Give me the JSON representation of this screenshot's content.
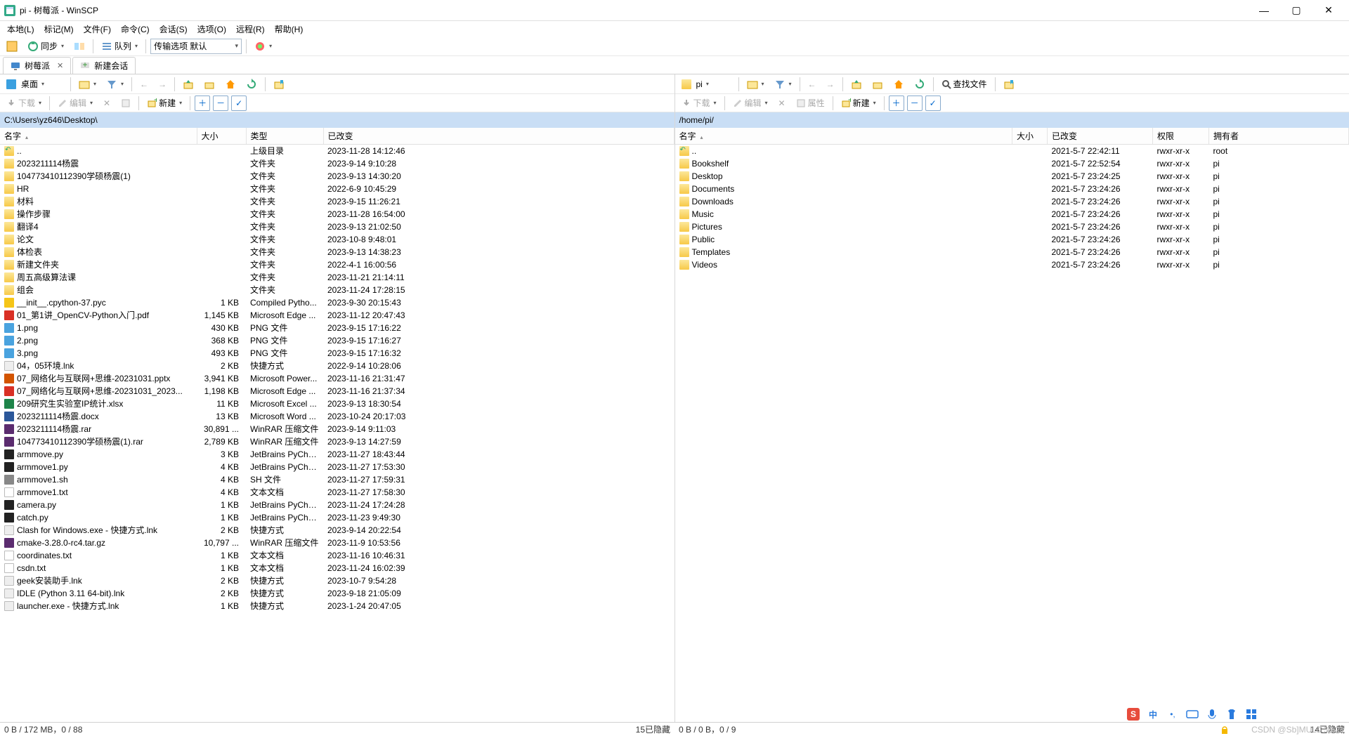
{
  "window": {
    "title": "pi - 树莓派 - WinSCP"
  },
  "menubar": [
    "本地(L)",
    "标记(M)",
    "文件(F)",
    "命令(C)",
    "会话(S)",
    "选项(O)",
    "远程(R)",
    "帮助(H)"
  ],
  "toolbar1": {
    "sync": "同步",
    "queue": "队列",
    "transfer": "传输选项 默认"
  },
  "tabs": {
    "session": "树莓派",
    "newsession": "新建会话"
  },
  "left": {
    "drive": "桌面",
    "path": "C:\\Users\\yz646\\Desktop\\",
    "edit": "编辑",
    "new": "新建",
    "download": "下载",
    "cols": {
      "name": "名字",
      "size": "大小",
      "type": "类型",
      "changed": "已改变"
    },
    "rows": [
      {
        "ic": "up",
        "name": "..",
        "size": "",
        "type": "上级目录",
        "changed": "2023-11-28  14:12:46"
      },
      {
        "ic": "folder",
        "name": "2023211114杨震",
        "size": "",
        "type": "文件夹",
        "changed": "2023-9-14  9:10:28"
      },
      {
        "ic": "folder",
        "name": "104773410112390学硕杨震(1)",
        "size": "",
        "type": "文件夹",
        "changed": "2023-9-13  14:30:20"
      },
      {
        "ic": "folder",
        "name": "HR",
        "size": "",
        "type": "文件夹",
        "changed": "2022-6-9  10:45:29"
      },
      {
        "ic": "folder",
        "name": "材料",
        "size": "",
        "type": "文件夹",
        "changed": "2023-9-15  11:26:21"
      },
      {
        "ic": "folder",
        "name": "操作步骤",
        "size": "",
        "type": "文件夹",
        "changed": "2023-11-28  16:54:00"
      },
      {
        "ic": "folder",
        "name": "翻译4",
        "size": "",
        "type": "文件夹",
        "changed": "2023-9-13  21:02:50"
      },
      {
        "ic": "folder",
        "name": "论文",
        "size": "",
        "type": "文件夹",
        "changed": "2023-10-8  9:48:01"
      },
      {
        "ic": "folder",
        "name": "体检表",
        "size": "",
        "type": "文件夹",
        "changed": "2023-9-13  14:38:23"
      },
      {
        "ic": "folder",
        "name": "新建文件夹",
        "size": "",
        "type": "文件夹",
        "changed": "2022-4-1  16:00:56"
      },
      {
        "ic": "folder",
        "name": "周五高级算法课",
        "size": "",
        "type": "文件夹",
        "changed": "2023-11-21  21:14:11"
      },
      {
        "ic": "folder",
        "name": "组会",
        "size": "",
        "type": "文件夹",
        "changed": "2023-11-24  17:28:15"
      },
      {
        "ic": "pyc",
        "name": "__init__.cpython-37.pyc",
        "size": "1 KB",
        "type": "Compiled Pytho...",
        "changed": "2023-9-30  20:15:43"
      },
      {
        "ic": "pdf",
        "name": "01_第1讲_OpenCV-Python入门.pdf",
        "size": "1,145 KB",
        "type": "Microsoft Edge ...",
        "changed": "2023-11-12  20:47:43"
      },
      {
        "ic": "png",
        "name": "1.png",
        "size": "430 KB",
        "type": "PNG 文件",
        "changed": "2023-9-15  17:16:22"
      },
      {
        "ic": "png",
        "name": "2.png",
        "size": "368 KB",
        "type": "PNG 文件",
        "changed": "2023-9-15  17:16:27"
      },
      {
        "ic": "png",
        "name": "3.png",
        "size": "493 KB",
        "type": "PNG 文件",
        "changed": "2023-9-15  17:16:32"
      },
      {
        "ic": "lnk",
        "name": "04，05环境.lnk",
        "size": "2 KB",
        "type": "快捷方式",
        "changed": "2022-9-14  10:28:06"
      },
      {
        "ic": "pptx",
        "name": "07_网络化与互联网+思维-20231031.pptx",
        "size": "3,941 KB",
        "type": "Microsoft Power...",
        "changed": "2023-11-16  21:31:47"
      },
      {
        "ic": "pdf",
        "name": "07_网络化与互联网+思维-20231031_2023...",
        "size": "1,198 KB",
        "type": "Microsoft Edge ...",
        "changed": "2023-11-16  21:37:34"
      },
      {
        "ic": "xlsx",
        "name": "209研究生实验室IP统计.xlsx",
        "size": "11 KB",
        "type": "Microsoft Excel ...",
        "changed": "2023-9-13  18:30:54"
      },
      {
        "ic": "docx",
        "name": "2023211114杨震.docx",
        "size": "13 KB",
        "type": "Microsoft Word ...",
        "changed": "2023-10-24  20:17:03"
      },
      {
        "ic": "rar",
        "name": "2023211114杨震.rar",
        "size": "30,891 ...",
        "type": "WinRAR 压缩文件",
        "changed": "2023-9-14  9:11:03"
      },
      {
        "ic": "rar",
        "name": "104773410112390学硕杨震(1).rar",
        "size": "2,789 KB",
        "type": "WinRAR 压缩文件",
        "changed": "2023-9-13  14:27:59"
      },
      {
        "ic": "py",
        "name": "armmove.py",
        "size": "3 KB",
        "type": "JetBrains PyChar...",
        "changed": "2023-11-27  18:43:44"
      },
      {
        "ic": "py",
        "name": "armmove1.py",
        "size": "4 KB",
        "type": "JetBrains PyChar...",
        "changed": "2023-11-27  17:53:30"
      },
      {
        "ic": "sh",
        "name": "armmove1.sh",
        "size": "4 KB",
        "type": "SH 文件",
        "changed": "2023-11-27  17:59:31"
      },
      {
        "ic": "txt",
        "name": "armmove1.txt",
        "size": "4 KB",
        "type": "文本文档",
        "changed": "2023-11-27  17:58:30"
      },
      {
        "ic": "py",
        "name": "camera.py",
        "size": "1 KB",
        "type": "JetBrains PyChar...",
        "changed": "2023-11-24  17:24:28"
      },
      {
        "ic": "py",
        "name": "catch.py",
        "size": "1 KB",
        "type": "JetBrains PyChar...",
        "changed": "2023-11-23  9:49:30"
      },
      {
        "ic": "lnk",
        "name": "Clash for Windows.exe - 快捷方式.lnk",
        "size": "2 KB",
        "type": "快捷方式",
        "changed": "2023-9-14  20:22:54"
      },
      {
        "ic": "gz",
        "name": "cmake-3.28.0-rc4.tar.gz",
        "size": "10,797 ...",
        "type": "WinRAR 压缩文件",
        "changed": "2023-11-9  10:53:56"
      },
      {
        "ic": "txt",
        "name": "coordinates.txt",
        "size": "1 KB",
        "type": "文本文档",
        "changed": "2023-11-16  10:46:31"
      },
      {
        "ic": "txt",
        "name": "csdn.txt",
        "size": "1 KB",
        "type": "文本文档",
        "changed": "2023-11-24  16:02:39"
      },
      {
        "ic": "lnk",
        "name": "geek安装助手.lnk",
        "size": "2 KB",
        "type": "快捷方式",
        "changed": "2023-10-7  9:54:28"
      },
      {
        "ic": "lnk",
        "name": "IDLE (Python 3.11 64-bit).lnk",
        "size": "2 KB",
        "type": "快捷方式",
        "changed": "2023-9-18  21:05:09"
      },
      {
        "ic": "lnk",
        "name": "launcher.exe - 快捷方式.lnk",
        "size": "1 KB",
        "type": "快捷方式",
        "changed": "2023-1-24  20:47:05"
      }
    ],
    "status_left": "0 B / 172 MB，0 / 88",
    "status_right": "15已隐藏"
  },
  "right": {
    "drive": "pi",
    "path": "/home/pi/",
    "edit": "编辑",
    "new": "新建",
    "upload": "下载",
    "find": "查找文件",
    "props": "属性",
    "cols": {
      "name": "名字",
      "size": "大小",
      "changed": "已改变",
      "rights": "权限",
      "owner": "拥有者"
    },
    "rows": [
      {
        "ic": "up",
        "name": "..",
        "size": "",
        "changed": "2021-5-7 22:42:11",
        "rights": "rwxr-xr-x",
        "owner": "root"
      },
      {
        "ic": "folder",
        "name": "Bookshelf",
        "size": "",
        "changed": "2021-5-7 22:52:54",
        "rights": "rwxr-xr-x",
        "owner": "pi"
      },
      {
        "ic": "folder",
        "name": "Desktop",
        "size": "",
        "changed": "2021-5-7 23:24:25",
        "rights": "rwxr-xr-x",
        "owner": "pi"
      },
      {
        "ic": "folder",
        "name": "Documents",
        "size": "",
        "changed": "2021-5-7 23:24:26",
        "rights": "rwxr-xr-x",
        "owner": "pi"
      },
      {
        "ic": "folder",
        "name": "Downloads",
        "size": "",
        "changed": "2021-5-7 23:24:26",
        "rights": "rwxr-xr-x",
        "owner": "pi"
      },
      {
        "ic": "folder",
        "name": "Music",
        "size": "",
        "changed": "2021-5-7 23:24:26",
        "rights": "rwxr-xr-x",
        "owner": "pi"
      },
      {
        "ic": "folder",
        "name": "Pictures",
        "size": "",
        "changed": "2021-5-7 23:24:26",
        "rights": "rwxr-xr-x",
        "owner": "pi"
      },
      {
        "ic": "folder",
        "name": "Public",
        "size": "",
        "changed": "2021-5-7 23:24:26",
        "rights": "rwxr-xr-x",
        "owner": "pi"
      },
      {
        "ic": "folder",
        "name": "Templates",
        "size": "",
        "changed": "2021-5-7 23:24:26",
        "rights": "rwxr-xr-x",
        "owner": "pi"
      },
      {
        "ic": "folder",
        "name": "Videos",
        "size": "",
        "changed": "2021-5-7 23:24:26",
        "rights": "rwxr-xr-x",
        "owner": "pi"
      }
    ],
    "status_left": "0 B / 0 B，0 / 9",
    "status_right": "14已隐藏"
  },
  "watermark": "CSDN @Sb]MUL0:30:21"
}
